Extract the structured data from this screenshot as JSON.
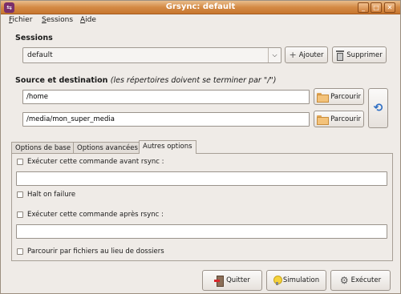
{
  "window": {
    "title": "Grsync: default"
  },
  "menu": {
    "items": [
      "Fichier",
      "Sessions",
      "Aide"
    ]
  },
  "sessions": {
    "heading": "Sessions",
    "selected": "default",
    "add_label": "Ajouter",
    "delete_label": "Supprimer"
  },
  "source_dest": {
    "heading": "Source et destination",
    "hint": "(les répertoires doivent se terminer par \"/\")",
    "source_value": "/home",
    "dest_value": "/media/mon_super_media",
    "browse_label": "Parcourir"
  },
  "tabs": [
    "Options de base",
    "Options avancées",
    "Autres options"
  ],
  "options": {
    "before_cmd_label": "Exécuter cette commande avant rsync :",
    "before_cmd_value": "",
    "halt_label": "Halt on failure",
    "after_cmd_label": "Exécuter cette commande après rsync :",
    "after_cmd_value": "",
    "browse_files_label": "Parcourir par fichiers au lieu de dossiers"
  },
  "actions": {
    "quit_label": "Quitter",
    "simulation_label": "Simulation",
    "execute_label": "Exécuter"
  }
}
